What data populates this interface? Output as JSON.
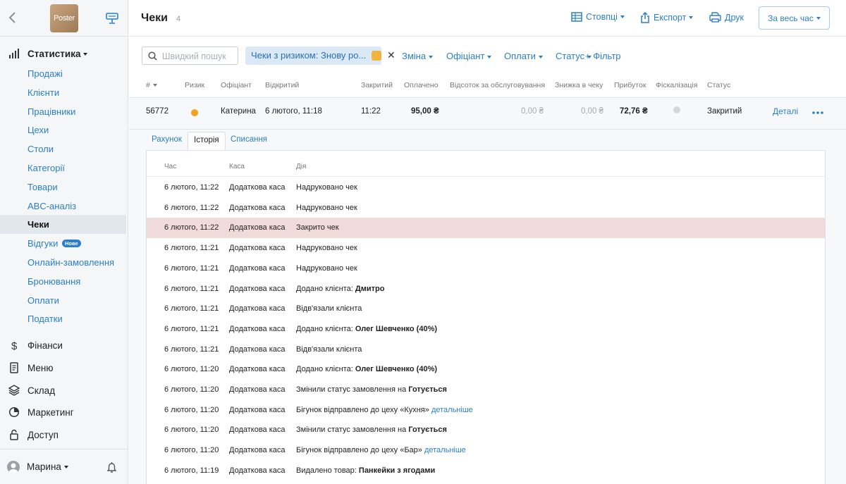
{
  "sidebar": {
    "logo_text": "Poster",
    "nav": {
      "statistics": "Статистика",
      "finance": "Фінанси",
      "menu": "Меню",
      "warehouse": "Склад",
      "marketing": "Маркетинг",
      "access": "Доступ"
    },
    "sub_items": [
      {
        "label": "Продажі"
      },
      {
        "label": "Клієнти"
      },
      {
        "label": "Працівники"
      },
      {
        "label": "Цехи"
      },
      {
        "label": "Столи"
      },
      {
        "label": "Категорії"
      },
      {
        "label": "Товари"
      },
      {
        "label": "ABC-аналіз"
      },
      {
        "label": "Чеки",
        "active": true
      },
      {
        "label": "Відгуки",
        "badge": "Нове"
      },
      {
        "label": "Онлайн-замовлення"
      },
      {
        "label": "Бронювання"
      },
      {
        "label": "Оплати"
      },
      {
        "label": "Податки"
      }
    ],
    "user": "Марина"
  },
  "header": {
    "title": "Чеки",
    "count": "4",
    "columns_btn": "Стовпці",
    "export_btn": "Експорт",
    "print_btn": "Друк",
    "period_btn": "За весь час"
  },
  "filters": {
    "search_placeholder": "Швидкий пошук",
    "active_filter": "Чеки з ризиком: Знову ро...",
    "shift": "Зміна",
    "waiter": "Офіціант",
    "payments": "Оплати",
    "status": "Статус",
    "add_filter": "+ Фільтр"
  },
  "table": {
    "headers": {
      "num": "#",
      "risk": "Ризик",
      "waiter": "Офіціант",
      "opened": "Відкритий",
      "closed": "Закритий",
      "paid": "Оплачено",
      "service": "Відсоток за обслуговування",
      "discount": "Знижка в чеку",
      "profit": "Прибуток",
      "fiscal": "Фіскалізація",
      "status": "Статус"
    },
    "row": {
      "num": "56772",
      "waiter": "Катерина",
      "opened": "6 лютого, 11:18",
      "closed": "11:22",
      "paid": "95,00 ₴",
      "service": "0,00 ₴",
      "discount": "0,00 ₴",
      "profit": "72,76 ₴",
      "status": "Закритий",
      "details": "Деталі"
    }
  },
  "tabs": {
    "receipt": "Рахунок",
    "history": "Історія",
    "writeoffs": "Списання"
  },
  "history": {
    "headers": {
      "time": "Час",
      "register": "Каса",
      "action": "Дія"
    },
    "rows": [
      {
        "time": "6 лютого, 11:22",
        "register": "Додаткова каса",
        "text": "Надруковано чек"
      },
      {
        "time": "6 лютого, 11:22",
        "register": "Додаткова каса",
        "text": "Надруковано чек"
      },
      {
        "time": "6 лютого, 11:22",
        "register": "Додаткова каса",
        "text": "Закрито чек",
        "highlight": true
      },
      {
        "time": "6 лютого, 11:21",
        "register": "Додаткова каса",
        "text": "Надруковано чек"
      },
      {
        "time": "6 лютого, 11:21",
        "register": "Додаткова каса",
        "text": "Надруковано чек"
      },
      {
        "time": "6 лютого, 11:21",
        "register": "Додаткова каса",
        "text": "Додано клієнта: ",
        "bold": "Дмитро"
      },
      {
        "time": "6 лютого, 11:21",
        "register": "Додаткова каса",
        "text": "Відв'язали клієнта"
      },
      {
        "time": "6 лютого, 11:21",
        "register": "Додаткова каса",
        "text": "Додано клієнта: ",
        "bold": "Олег Шевченко (40%)"
      },
      {
        "time": "6 лютого, 11:21",
        "register": "Додаткова каса",
        "text": "Відв'язали клієнта"
      },
      {
        "time": "6 лютого, 11:20",
        "register": "Додаткова каса",
        "text": "Додано клієнта: ",
        "bold": "Олег Шевченко (40%)"
      },
      {
        "time": "6 лютого, 11:20",
        "register": "Додаткова каса",
        "text": "Змінили статус замовлення на ",
        "bold": "Готується"
      },
      {
        "time": "6 лютого, 11:20",
        "register": "Додаткова каса",
        "text": "Бігунок відправлено до цеху «Кухня» ",
        "link": "детальніше"
      },
      {
        "time": "6 лютого, 11:20",
        "register": "Додаткова каса",
        "text": "Змінили статус замовлення на ",
        "bold": "Готується"
      },
      {
        "time": "6 лютого, 11:20",
        "register": "Додаткова каса",
        "text": "Бігунок відправлено до цеху «Бар» ",
        "link": "детальніше"
      },
      {
        "time": "6 лютого, 11:19",
        "register": "Додаткова каса",
        "text": "Видалено товар: ",
        "bold": "Панкейки з ягодами"
      }
    ]
  }
}
